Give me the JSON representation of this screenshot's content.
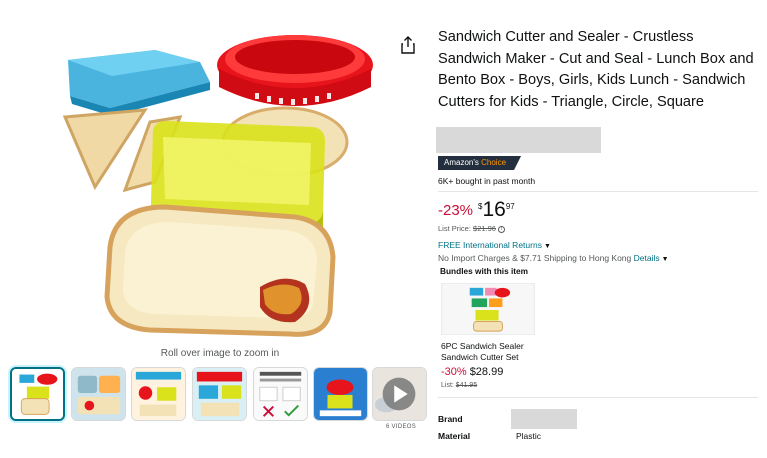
{
  "product": {
    "title": "Sandwich Cutter and Sealer - Crustless Sandwich Maker - Cut and Seal - Lunch Box and Bento Box - Boys, Girls, Kids Lunch - Sandwich Cutters for Kids - Triangle, Circle, Square",
    "badge_prefix": "Amazon's",
    "badge_accent": "Choice",
    "bought": "6K+ bought in past month"
  },
  "price": {
    "discount": "-23%",
    "symbol": "$",
    "whole": "16",
    "fraction": "97",
    "list_label": "List Price:",
    "list_value": "$21.96",
    "info_icon": "i"
  },
  "delivery": {
    "returns_text": "FREE International Returns",
    "import_text": "No Import Charges & $7.71 Shipping to Hong Kong",
    "details_link": "Details"
  },
  "bundle": {
    "heading": "Bundles with this item",
    "name": "6PC Sandwich Sealer Sandwich Cutter Set",
    "discount": "-30%",
    "price": "$28.99",
    "list_label": "List:",
    "list_value": "$41.95"
  },
  "specs": [
    {
      "label": "Brand",
      "value": ""
    },
    {
      "label": "Material",
      "value": "Plastic"
    }
  ],
  "gallery": {
    "zoom_hint": "Roll over image to zoom in",
    "videos_label": "6 VIDEOS",
    "thumbnail_count": 7,
    "selected_index": 0
  },
  "icons": {
    "share": "share-icon",
    "play": "play-icon",
    "caret": "chevron-down-icon"
  },
  "colors": {
    "discount_red": "#cc0c39",
    "link_teal": "#007185",
    "badge_navy": "#232f3e",
    "badge_orange": "#ff9900",
    "selected_thumb": "#007185"
  }
}
